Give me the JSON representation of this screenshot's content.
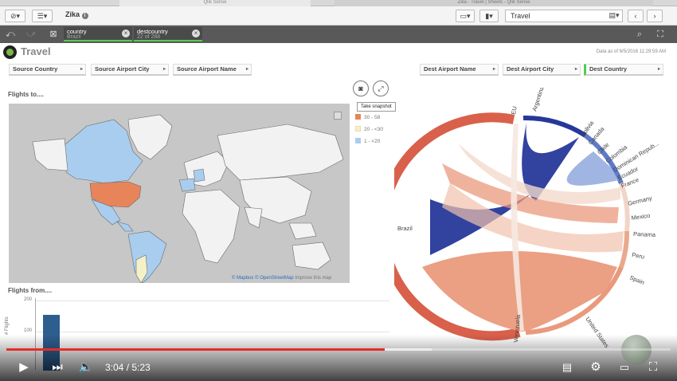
{
  "browser": {
    "tab1": "Qlik Sense",
    "tab2": "Zika - Travel | Sheets - Qlik Sense"
  },
  "toolbar": {
    "app_title": "Zika",
    "sheet_selector": "Travel"
  },
  "selections": [
    {
      "field": "country",
      "value": "Brazil"
    },
    {
      "field": "destcountry",
      "value": "22 of 288"
    }
  ],
  "sheet": {
    "title": "Travel",
    "data_asof": "Data as of 6/5/2016 11:29:59 AM"
  },
  "filters": {
    "source_country": "Source Country",
    "source_airport_city": "Source Airport City",
    "source_airport_name": "Source Airport Name",
    "dest_airport_name": "Dest Airport Name",
    "dest_airport_city": "Dest Airport City",
    "dest_country": "Dest Country"
  },
  "map": {
    "title": "Flights to....",
    "tooltip": "Take snapshot",
    "legend": [
      {
        "label": "30 - 58",
        "color": "#e8845a"
      },
      {
        "label": "20 - <30",
        "color": "#f5f0c8"
      },
      {
        "label": "1 - <20",
        "color": "#a9cdee"
      }
    ],
    "attribution_link": "© Mapbox © OpenStreetMap",
    "attribution_text": "Improve this map"
  },
  "flights_from": {
    "title": "Flights from....",
    "ylabel": "# Flights",
    "ticks": [
      "200",
      "100"
    ]
  },
  "chart_data": {
    "type": "chord",
    "source": "Brazil",
    "destinations": [
      "EU",
      "Argentina",
      "Bolivia",
      "Canada",
      "Chile",
      "Colombia",
      "Dominican Repub...",
      "Ecuador",
      "France",
      "Germany",
      "Mexico",
      "Panama",
      "Peru",
      "Spain",
      "United States",
      "Venezuela"
    ]
  },
  "player": {
    "time": "3:04 / 5:23",
    "played_fraction": 0.569,
    "loaded_fraction": 0.64
  }
}
